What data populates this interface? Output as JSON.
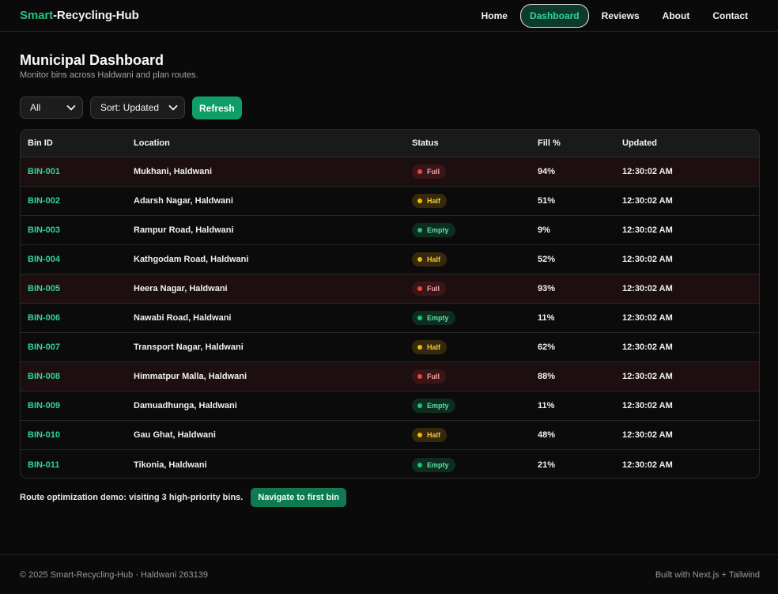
{
  "brand": {
    "accent": "Smart",
    "rest": "-Recycling-Hub"
  },
  "nav": [
    {
      "label": "Home",
      "active": false
    },
    {
      "label": "Dashboard",
      "active": true
    },
    {
      "label": "Reviews",
      "active": false
    },
    {
      "label": "About",
      "active": false
    },
    {
      "label": "Contact",
      "active": false
    }
  ],
  "page": {
    "title": "Municipal Dashboard",
    "subtitle": "Monitor bins across Haldwani and plan routes."
  },
  "controls": {
    "filter_value": "All",
    "sort_value": "Sort: Updated",
    "refresh_label": "Refresh"
  },
  "table": {
    "headers": [
      "Bin ID",
      "Location",
      "Status",
      "Fill %",
      "Updated"
    ],
    "rows": [
      {
        "id": "BIN-001",
        "location": "Mukhani, Haldwani",
        "status": "Full",
        "fill": "94%",
        "updated": "12:30:02 AM"
      },
      {
        "id": "BIN-002",
        "location": "Adarsh Nagar, Haldwani",
        "status": "Half",
        "fill": "51%",
        "updated": "12:30:02 AM"
      },
      {
        "id": "BIN-003",
        "location": "Rampur Road, Haldwani",
        "status": "Empty",
        "fill": "9%",
        "updated": "12:30:02 AM"
      },
      {
        "id": "BIN-004",
        "location": "Kathgodam Road, Haldwani",
        "status": "Half",
        "fill": "52%",
        "updated": "12:30:02 AM"
      },
      {
        "id": "BIN-005",
        "location": "Heera Nagar, Haldwani",
        "status": "Full",
        "fill": "93%",
        "updated": "12:30:02 AM"
      },
      {
        "id": "BIN-006",
        "location": "Nawabi Road, Haldwani",
        "status": "Empty",
        "fill": "11%",
        "updated": "12:30:02 AM"
      },
      {
        "id": "BIN-007",
        "location": "Transport Nagar, Haldwani",
        "status": "Half",
        "fill": "62%",
        "updated": "12:30:02 AM"
      },
      {
        "id": "BIN-008",
        "location": "Himmatpur Malla, Haldwani",
        "status": "Full",
        "fill": "88%",
        "updated": "12:30:02 AM"
      },
      {
        "id": "BIN-009",
        "location": "Damuadhunga, Haldwani",
        "status": "Empty",
        "fill": "11%",
        "updated": "12:30:02 AM"
      },
      {
        "id": "BIN-010",
        "location": "Gau Ghat, Haldwani",
        "status": "Half",
        "fill": "48%",
        "updated": "12:30:02 AM"
      },
      {
        "id": "BIN-011",
        "location": "Tikonia, Haldwani",
        "status": "Empty",
        "fill": "21%",
        "updated": "12:30:02 AM"
      }
    ]
  },
  "route": {
    "text": "Route optimization demo: visiting 3 high-priority bins.",
    "button_label": "Navigate to first bin"
  },
  "footer": {
    "left": "© 2025 Smart-Recycling-Hub · Haldwani 263139",
    "right": "Built with Next.js + Tailwind"
  },
  "colors": {
    "accent": "#22c37a",
    "full": "#ef4444",
    "half": "#f5b800",
    "empty": "#22c37a"
  }
}
